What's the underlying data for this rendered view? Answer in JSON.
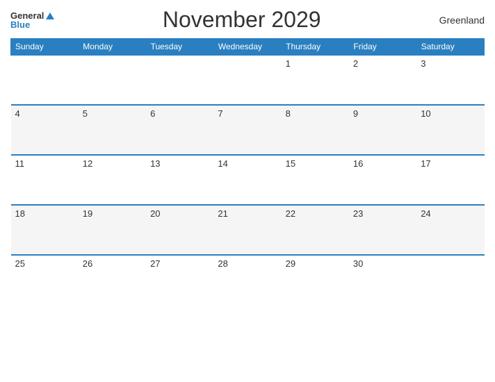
{
  "header": {
    "logo_general": "General",
    "logo_blue": "Blue",
    "title": "November 2029",
    "region": "Greenland"
  },
  "weekdays": [
    "Sunday",
    "Monday",
    "Tuesday",
    "Wednesday",
    "Thursday",
    "Friday",
    "Saturday"
  ],
  "weeks": [
    [
      "",
      "",
      "",
      "",
      "1",
      "2",
      "3"
    ],
    [
      "4",
      "5",
      "6",
      "7",
      "8",
      "9",
      "10"
    ],
    [
      "11",
      "12",
      "13",
      "14",
      "15",
      "16",
      "17"
    ],
    [
      "18",
      "19",
      "20",
      "21",
      "22",
      "23",
      "24"
    ],
    [
      "25",
      "26",
      "27",
      "28",
      "29",
      "30",
      ""
    ]
  ],
  "accent_color": "#2a7fc1"
}
